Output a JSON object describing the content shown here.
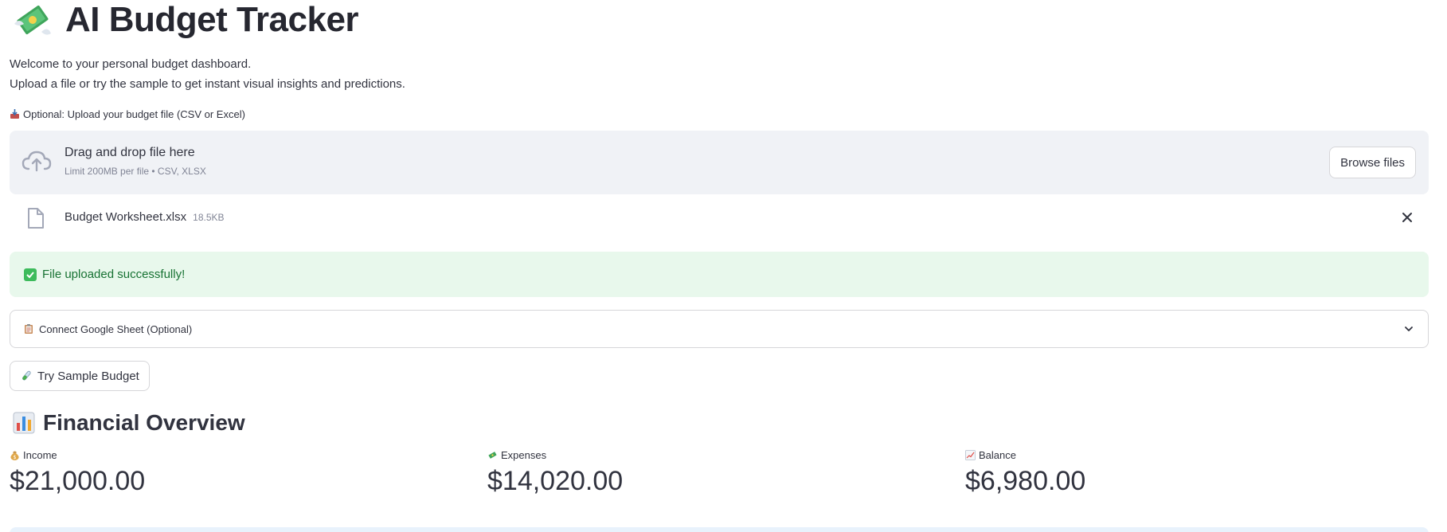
{
  "header": {
    "title": "AI Budget Tracker",
    "icon": "money-with-wings-icon"
  },
  "intro": {
    "line1": "Welcome to your personal budget dashboard.",
    "line2": "Upload a file or try the sample to get instant visual insights and predictions."
  },
  "uploader": {
    "label": "Optional: Upload your budget file (CSV or Excel)",
    "drop_title": "Drag and drop file here",
    "drop_sub": "Limit 200MB per file • CSV, XLSX",
    "browse_label": "Browse files",
    "file_name": "Budget Worksheet.xlsx",
    "file_size": "18.5KB"
  },
  "success": {
    "message": "File uploaded successfully!"
  },
  "expander": {
    "label": "Connect Google Sheet (Optional)"
  },
  "sample_button": {
    "label": "Try Sample Budget"
  },
  "overview": {
    "title": "Financial Overview",
    "metrics": [
      {
        "label": "Income",
        "value": "$21,000.00",
        "icon": "money-bag-icon"
      },
      {
        "label": "Expenses",
        "value": "$14,020.00",
        "icon": "money-with-wings-icon"
      },
      {
        "label": "Balance",
        "value": "$6,980.00",
        "icon": "chart-increasing-icon"
      }
    ]
  },
  "colors": {
    "success_bg": "#e8f8ec",
    "success_text": "#177233",
    "dropzone_bg": "#f0f2f6",
    "info_bg": "#e8f2fc"
  }
}
